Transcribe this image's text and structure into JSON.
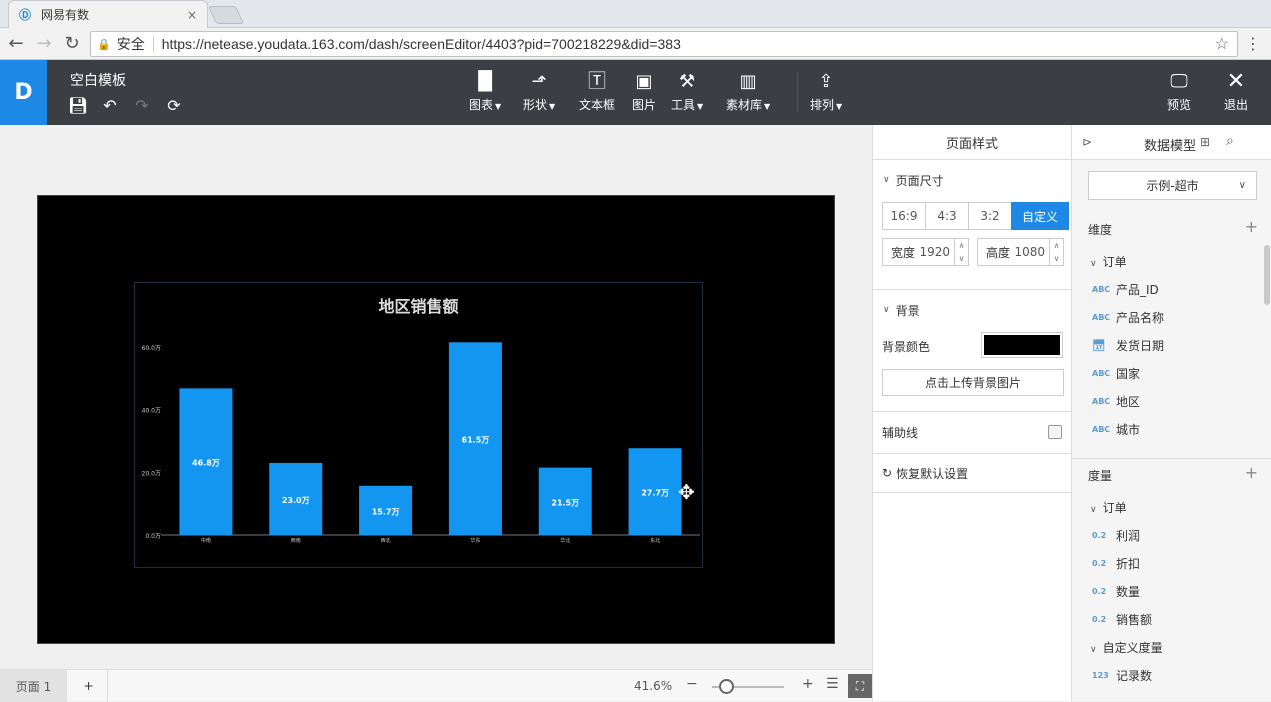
{
  "browser": {
    "tab_title": "网易有数",
    "tab_close": "×",
    "secure_label": "安全",
    "url": "https://netease.youdata.163.com/dash/screenEditor/4403?pid=700218229&did=383"
  },
  "app": {
    "logo": "D",
    "doc_title": "空白模板",
    "tools": [
      {
        "label": "图表",
        "icon": "bar-chart-icon",
        "has_menu": true
      },
      {
        "label": "形状",
        "icon": "shape-icon",
        "has_menu": true
      },
      {
        "label": "文本框",
        "icon": "textbox-icon",
        "has_menu": false
      },
      {
        "label": "图片",
        "icon": "image-icon",
        "has_menu": false
      },
      {
        "label": "工具",
        "icon": "hammer-icon",
        "has_menu": true
      },
      {
        "label": "素材库",
        "icon": "library-icon",
        "has_menu": true
      },
      {
        "label": "排列",
        "icon": "arrange-icon",
        "has_menu": true
      }
    ],
    "preview_label": "预览",
    "exit_label": "退出"
  },
  "canvas": {
    "background_color": "#000000",
    "zoom": "41.6%",
    "zoom_level": 0.2,
    "page_tab": "页面 1",
    "add_page": "+"
  },
  "chart_data": {
    "type": "bar",
    "title": "地区销售额",
    "categories": [
      "中南",
      "西南",
      "西北",
      "华东",
      "华北",
      "东北"
    ],
    "values": [
      46.8,
      23.0,
      15.7,
      61.5,
      21.5,
      27.7
    ],
    "value_labels": [
      "46.8万",
      "23.0万",
      "15.7万",
      "61.5万",
      "21.5万",
      "27.7万"
    ],
    "y_ticks": [
      "0.0万",
      "20.0万",
      "40.0万",
      "60.0万"
    ],
    "ylim": [
      0,
      60
    ],
    "bar_color": "#1296f0"
  },
  "style_panel": {
    "title": "页面样式",
    "size_section": "页面尺寸",
    "ratios": [
      "16:9",
      "4:3",
      "3:2",
      "自定义"
    ],
    "active_ratio": "自定义",
    "width_label": "宽度",
    "width_value": "1920",
    "height_label": "高度",
    "height_value": "1080",
    "bg_section": "背景",
    "bg_color_label": "背景颜色",
    "upload_bg": "点击上传背景图片",
    "guideline_label": "辅助线",
    "reset_label": "恢复默认设置"
  },
  "data_panel": {
    "title": "数据模型",
    "model_select": "示例-超市",
    "dimensions_label": "维度",
    "dim_folder": "订单",
    "dimensions": [
      {
        "type": "ABC",
        "name": "产品_ID"
      },
      {
        "type": "ABC",
        "name": "产品名称"
      },
      {
        "type": "date",
        "name": "发货日期"
      },
      {
        "type": "ABC",
        "name": "国家"
      },
      {
        "type": "ABC",
        "name": "地区"
      },
      {
        "type": "ABC",
        "name": "城市"
      }
    ],
    "measures_label": "度量",
    "measure_folder": "订单",
    "measures": [
      {
        "type": "0.2",
        "name": "利润"
      },
      {
        "type": "0.2",
        "name": "折扣"
      },
      {
        "type": "0.2",
        "name": "数量"
      },
      {
        "type": "0.2",
        "name": "销售额"
      }
    ],
    "custom_folder": "自定义度量",
    "custom_measures": [
      {
        "type": "123",
        "name": "记录数"
      }
    ]
  }
}
